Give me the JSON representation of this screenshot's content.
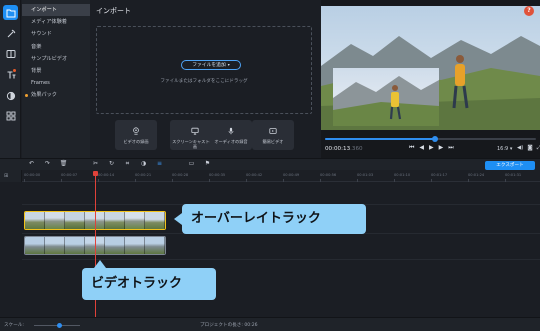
{
  "icon_sidebar": [
    {
      "icon": "import-icon",
      "active": true
    },
    {
      "icon": "magic-wand-icon",
      "active": false
    },
    {
      "icon": "filters-icon",
      "active": false
    },
    {
      "icon": "titles-icon",
      "active": false,
      "dot": true
    },
    {
      "icon": "transitions-icon",
      "active": false
    },
    {
      "icon": "more-tools-icon",
      "active": false
    }
  ],
  "categories": [
    {
      "label": "インポート",
      "active": true
    },
    {
      "label": "メディア体験着",
      "active": false
    },
    {
      "label": "サウンド",
      "active": false
    },
    {
      "label": "音楽",
      "active": false
    },
    {
      "label": "サンプルビデオ",
      "active": false
    },
    {
      "label": "背景",
      "active": false
    },
    {
      "label": "Frames",
      "active": false
    },
    {
      "label": "効果パック",
      "active": false,
      "dot": true
    }
  ],
  "import_pane": {
    "title": "インポート",
    "add_files_label": "ファイルを追加",
    "drop_hint": "ファイルまたはフォルダをここにドラッグ",
    "tiles": [
      {
        "label": "ビデオの録画",
        "icon": "webcam-icon"
      },
      {
        "label": "スクリーンキャストの録画",
        "icon": "screen-record-icon"
      },
      {
        "label": "オーディオの録音",
        "icon": "microphone-icon"
      },
      {
        "label": "簡易ビデオ",
        "icon": "quick-video-icon"
      }
    ]
  },
  "player": {
    "help_badge": "?",
    "timecode": "00:00:13",
    "timecode_ms": ".360",
    "progress": 0.52,
    "aspect_ratio": "16:9",
    "volume_icon": "volume-icon",
    "snapshot_icon": "camera-icon",
    "fullscreen_icon": "fullscreen-icon"
  },
  "toolbar": {
    "export_label": "エクスポート",
    "tools": [
      "undo-icon",
      "redo-icon",
      "delete-icon",
      "cut-icon",
      "rotate-icon",
      "crop-icon",
      "color-adjust-icon",
      "clip-properties-icon",
      "insert-icon",
      "flag-icon"
    ]
  },
  "ruler": {
    "labels": [
      "00:00:00",
      "00:00:07",
      "00:00:14",
      "00:00:21",
      "00:00:28",
      "00:00:35",
      "00:00:42",
      "00:00:49",
      "00:00:56",
      "00:01:03",
      "00:01:10",
      "00:01:17",
      "00:01:24",
      "00:01:31"
    ]
  },
  "timeline": {
    "playhead_time": "00:00:13"
  },
  "callouts": {
    "overlay_track": "オーバーレイトラック",
    "video_track": "ビデオトラック"
  },
  "statusbar": {
    "scale_label": "スケール:",
    "zoom_level": 0.55,
    "duration_label": "プロジェクトの長さ: 00:26"
  },
  "colors": {
    "accent": "#1e8ff4",
    "overlay_clip_border": "#f2c21a",
    "playhead": "#e0423a",
    "callout_bg": "#8fd0f7"
  }
}
